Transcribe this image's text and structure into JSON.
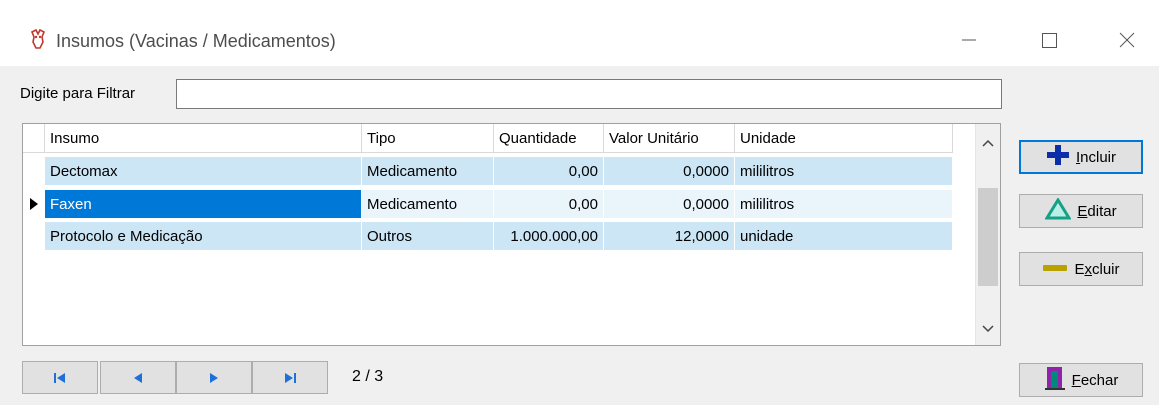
{
  "window": {
    "title": "Insumos (Vacinas / Medicamentos)",
    "controls": [
      "minimize",
      "maximize",
      "close"
    ]
  },
  "filter": {
    "label": "Digite para Filtrar",
    "value": ""
  },
  "grid": {
    "columns": [
      "Insumo",
      "Tipo",
      "Quantidade",
      "Valor Unitário",
      "Unidade"
    ],
    "rows": [
      {
        "insumo": "Dectomax",
        "tipo": "Medicamento",
        "quantidade": "0,00",
        "valor_unitario": "0,0000",
        "unidade": "mililitros"
      },
      {
        "insumo": "Faxen",
        "tipo": "Medicamento",
        "quantidade": "0,00",
        "valor_unitario": "0,0000",
        "unidade": "mililitros"
      },
      {
        "insumo": "Protocolo e Medicação",
        "tipo": "Outros",
        "quantidade": "1.000.000,00",
        "valor_unitario": "12,0000",
        "unidade": "unidade"
      }
    ],
    "selected_row": 2
  },
  "actions": {
    "incluir": "Incluir",
    "editar": "Editar",
    "excluir": "Excluir",
    "fechar": "Fechar"
  },
  "navigation": {
    "page_indicator": "2 / 3"
  },
  "colors": {
    "selection": "#0078d7",
    "row_alt": "#cce6f6",
    "accent_plus": "#0b2fa8",
    "accent_edit": "#16a085",
    "accent_minus": "#b8a200"
  }
}
